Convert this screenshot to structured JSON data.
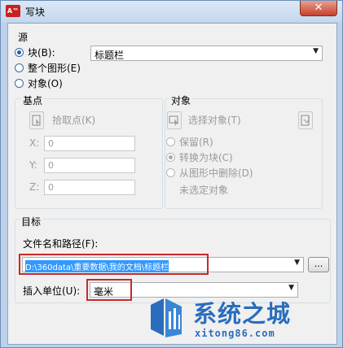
{
  "window": {
    "title": "写块",
    "icon_text": "A™",
    "close_glyph": "✕"
  },
  "source": {
    "group_label": "源",
    "options": [
      {
        "label": "块(B):",
        "selected": true
      },
      {
        "label": "整个图形(E)",
        "selected": false
      },
      {
        "label": "对象(O)",
        "selected": false
      }
    ],
    "block_value": "标题栏"
  },
  "base_point": {
    "group_label": "基点",
    "pick_label": "拾取点(K)",
    "x_label": "X:",
    "x_value": "0",
    "y_label": "Y:",
    "y_value": "0",
    "z_label": "Z:",
    "z_value": "0"
  },
  "objects": {
    "group_label": "对象",
    "select_label": "选择对象(T)",
    "options": [
      {
        "label": "保留(R)",
        "selected": false
      },
      {
        "label": "转换为块(C)",
        "selected": true
      },
      {
        "label": "从图形中删除(D)",
        "selected": false
      }
    ],
    "none_selected": "未选定对象"
  },
  "target": {
    "group_label": "目标",
    "path_label": "文件名和路径(F):",
    "path_value": "D:\\360data\\重要数据\\我的文档\\标题栏",
    "browse_label": "...",
    "units_label": "插入单位(U):",
    "units_value": "毫米"
  },
  "watermark": {
    "title": "系统之城",
    "subtitle": "xitong86.com"
  },
  "colors": {
    "highlight": "#c62a2a",
    "selection": "#3399ff",
    "watermark": "#2a6dbd"
  }
}
